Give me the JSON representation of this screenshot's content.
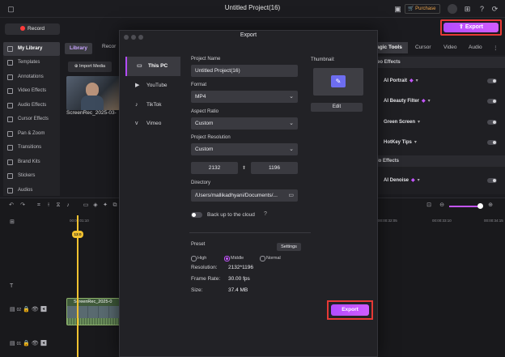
{
  "window": {
    "title": "Untitled Project(16)"
  },
  "header": {
    "purchase_label": "Purchase",
    "record_label": "Record",
    "export_label": "Export"
  },
  "sidebar": {
    "items": [
      {
        "label": "My Library"
      },
      {
        "label": "Templates"
      },
      {
        "label": "Annotations"
      },
      {
        "label": "Video Effects"
      },
      {
        "label": "Audio Effects"
      },
      {
        "label": "Cursor Effects"
      },
      {
        "label": "Pan & Zoom"
      },
      {
        "label": "Transitions"
      },
      {
        "label": "Brand Kits"
      },
      {
        "label": "Stickers"
      },
      {
        "label": "Audios"
      }
    ]
  },
  "library": {
    "tab_label": "Library",
    "record_tab": "Recor",
    "import_label": "Import Media",
    "clip_name": "ScreenRec_2025-03-"
  },
  "right_panel": {
    "tabs": [
      "agic Tools",
      "Cursor",
      "Video",
      "Audio"
    ],
    "section_video": "eo Effects",
    "section_audio": "io Effects",
    "features": [
      "AI Portrait",
      "AI Beauty Filter",
      "Green Screen",
      "HotKey Tips",
      "AI Denoise"
    ]
  },
  "timeline": {
    "ticks": [
      "00:00:01:10",
      "00:00:32:05",
      "00:00:33:10",
      "00:00:34:15"
    ],
    "playhead_label": "13:0",
    "clip_label": "ScreenRec_2025-0"
  },
  "modal": {
    "title": "Export",
    "destinations": [
      "This PC",
      "YouTube",
      "TikTok",
      "Vimeo"
    ],
    "project_name_label": "Project Name",
    "project_name": "Untitled Project(16)",
    "format_label": "Format",
    "format": "MP4",
    "aspect_label": "Aspect Ratio",
    "aspect": "Custom",
    "resolution_label": "Project Resolution",
    "resolution": "Custom",
    "width": "2132",
    "height": "1196",
    "directory_label": "Directory",
    "directory": "/Users/mallikadhyani/Documents/...",
    "cloud_label": "Back up to the cloud",
    "thumbnail_label": "Thumbnail:",
    "edit_label": "Edit",
    "preset_label": "Preset",
    "settings_label": "Settings",
    "presets": [
      "High",
      "Middle",
      "Normal"
    ],
    "selected_preset": "Middle",
    "spec_resolution_label": "Resolution:",
    "spec_resolution": "2132*1196",
    "spec_fps_label": "Frame Rate:",
    "spec_fps": "30.00 fps",
    "spec_size_label": "Size:",
    "spec_size": "37.4 MB",
    "export_label": "Export"
  }
}
